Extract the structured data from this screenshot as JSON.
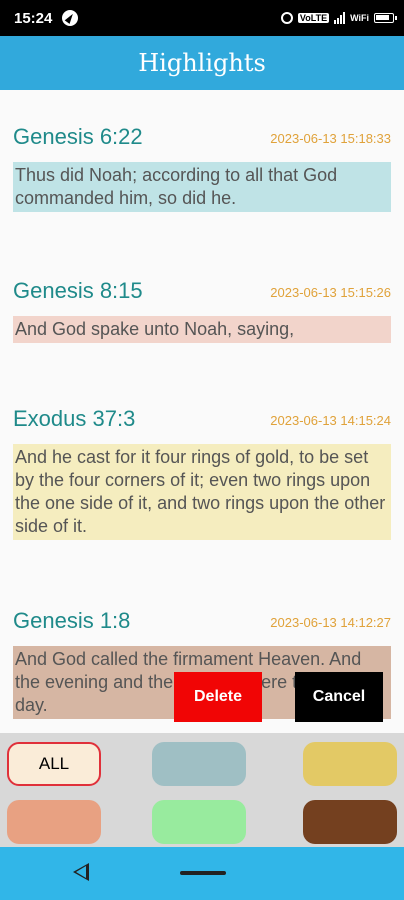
{
  "status_bar": {
    "time": "15:24",
    "icons": [
      "compass-icon",
      "alarm-icon",
      "volte-icon",
      "signal-icon",
      "wifi-icon",
      "battery-icon"
    ],
    "volte_label": "VoLTE",
    "wifi_label": "WiFi"
  },
  "app_bar": {
    "title": "Highlights"
  },
  "highlights": [
    {
      "reference": "Genesis 6:22",
      "timestamp": "2023-06-13 15:18:33",
      "text": "Thus did Noah; according to all that God commanded him, so did he.",
      "color": "#bfe3e6"
    },
    {
      "reference": "Genesis 8:15",
      "timestamp": "2023-06-13 15:15:26",
      "text": "And God spake unto Noah, saying,",
      "color": "#f2d4cb"
    },
    {
      "reference": "Exodus 37:3",
      "timestamp": "2023-06-13 14:15:24",
      "text": "And he cast for it four rings of gold, to be set by the four corners of it; even two rings upon the one side of it, and two rings upon the other side of it.",
      "color": "#f5edbf"
    },
    {
      "reference": "Genesis 1:8",
      "timestamp": "2023-06-13 14:12:27",
      "text": "And God called the firmament Heaven. And the evening and the morning were the second day.",
      "color": "#d6b6a3"
    }
  ],
  "actions": {
    "delete_label": "Delete",
    "cancel_label": "Cancel"
  },
  "palette": {
    "all_label": "ALL",
    "colors": [
      "#9fbfc4",
      "#e3c965",
      "#e8a182",
      "#98eb9e",
      "#74401f"
    ]
  },
  "nav_bar": {
    "icons": [
      "back-icon",
      "home-icon"
    ]
  }
}
